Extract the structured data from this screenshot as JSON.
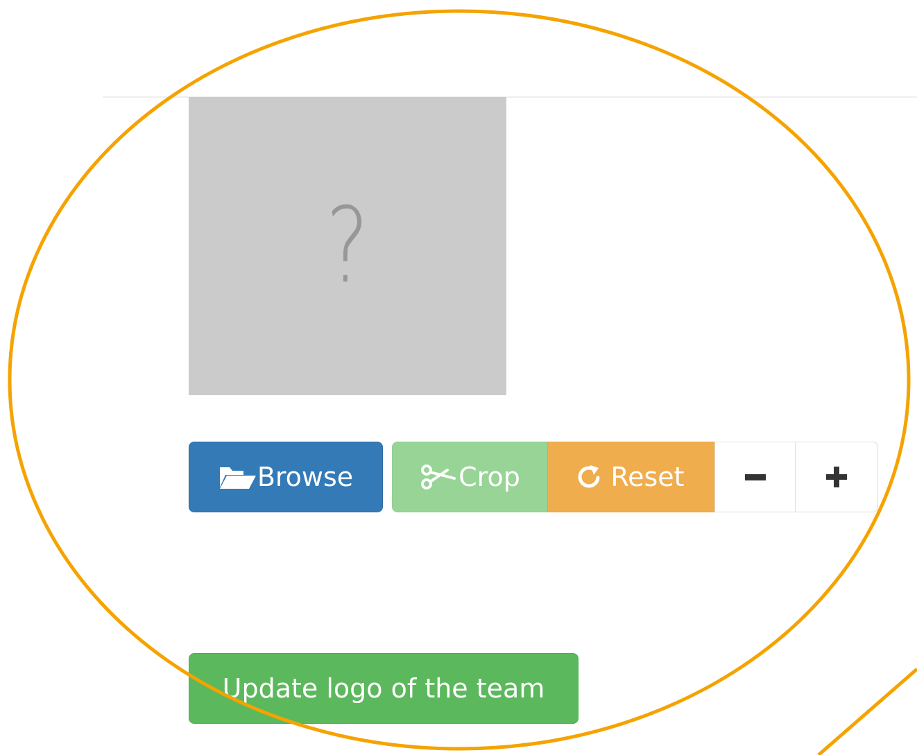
{
  "logo_preview": {
    "placeholder_glyph": "?"
  },
  "toolbar": {
    "browse_label": "Browse",
    "crop_label": "Crop",
    "reset_label": "Reset",
    "zoom_out_label": "−",
    "zoom_in_label": "+"
  },
  "actions": {
    "update_label": "Update logo of the team"
  },
  "icons": {
    "browse": "folder-open-icon",
    "crop": "scissors-icon",
    "reset": "refresh-icon",
    "zoom_out": "minus-icon",
    "zoom_in": "plus-icon"
  },
  "colors": {
    "browse": "#337ab7",
    "crop": "#97d496",
    "reset": "#f0ad4e",
    "update": "#5cb85c",
    "placeholder_bg": "#cbcbcb",
    "annotation": "#f5a300"
  }
}
